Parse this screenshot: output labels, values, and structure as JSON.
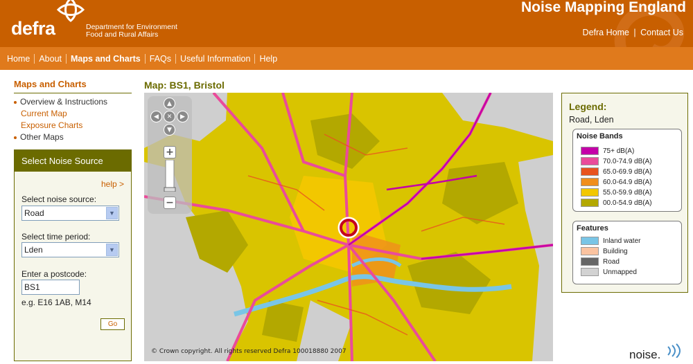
{
  "header": {
    "brand": "defra",
    "dept_line1": "Department for Environment",
    "dept_line2": "Food and Rural Affairs",
    "site_title": "Noise Mapping England",
    "links": [
      {
        "label": "Defra Home"
      },
      {
        "label": "Contact Us"
      }
    ],
    "link_separator": "|"
  },
  "nav": {
    "items": [
      {
        "label": "Home"
      },
      {
        "label": "About"
      },
      {
        "label": "Maps and Charts",
        "active": true
      },
      {
        "label": "FAQs"
      },
      {
        "label": "Useful Information"
      },
      {
        "label": "Help"
      }
    ]
  },
  "sidebar": {
    "heading": "Maps and Charts",
    "items": [
      {
        "label": "Overview & Instructions",
        "type": "bullet"
      },
      {
        "label": "Current Map",
        "type": "sub"
      },
      {
        "label": "Exposure Charts",
        "type": "sub"
      },
      {
        "label": "Other Maps",
        "type": "bullet"
      }
    ]
  },
  "source_panel": {
    "title": "Select Noise Source",
    "help": "help >",
    "source_label": "Select noise source:",
    "source_value": "Road",
    "period_label": "Select time period:",
    "period_value": "Lden",
    "postcode_label": "Enter a postcode:",
    "postcode_value": "BS1",
    "postcode_example": "e.g. E16 1AB, M14",
    "go_label": "Go"
  },
  "map": {
    "title": "Map: BS1, Bristol",
    "copyright": "© Crown copyright. All rights reserved Defra 100018880 2007",
    "controls": {
      "pan_up": "pan-up",
      "pan_down": "pan-down",
      "pan_left": "pan-left",
      "pan_right": "pan-right",
      "reset": "reset-view",
      "zoom_in": "+",
      "zoom_out": "−"
    }
  },
  "legend": {
    "heading": "Legend:",
    "subtitle": "Road, Lden",
    "noise_title": "Noise Bands",
    "noise_bands": [
      {
        "label": "75+ dB(A)",
        "color": "#c400a8"
      },
      {
        "label": "70.0-74.9 dB(A)",
        "color": "#ea4b9a"
      },
      {
        "label": "65.0-69.9 dB(A)",
        "color": "#e8531e"
      },
      {
        "label": "60.0-64.9 dB(A)",
        "color": "#f08e1c"
      },
      {
        "label": "55.0-59.9 dB(A)",
        "color": "#f2c700"
      },
      {
        "label": "00.0-54.9 dB(A)",
        "color": "#b3a800"
      }
    ],
    "features_title": "Features",
    "features": [
      {
        "label": "Inland water",
        "color": "#79c5e6"
      },
      {
        "label": "Building",
        "color": "#fbc3a0"
      },
      {
        "label": "Road",
        "color": "#666666"
      },
      {
        "label": "Unmapped",
        "color": "#d2d2d2"
      }
    ]
  },
  "footer": {
    "noise_logo": "noise."
  }
}
